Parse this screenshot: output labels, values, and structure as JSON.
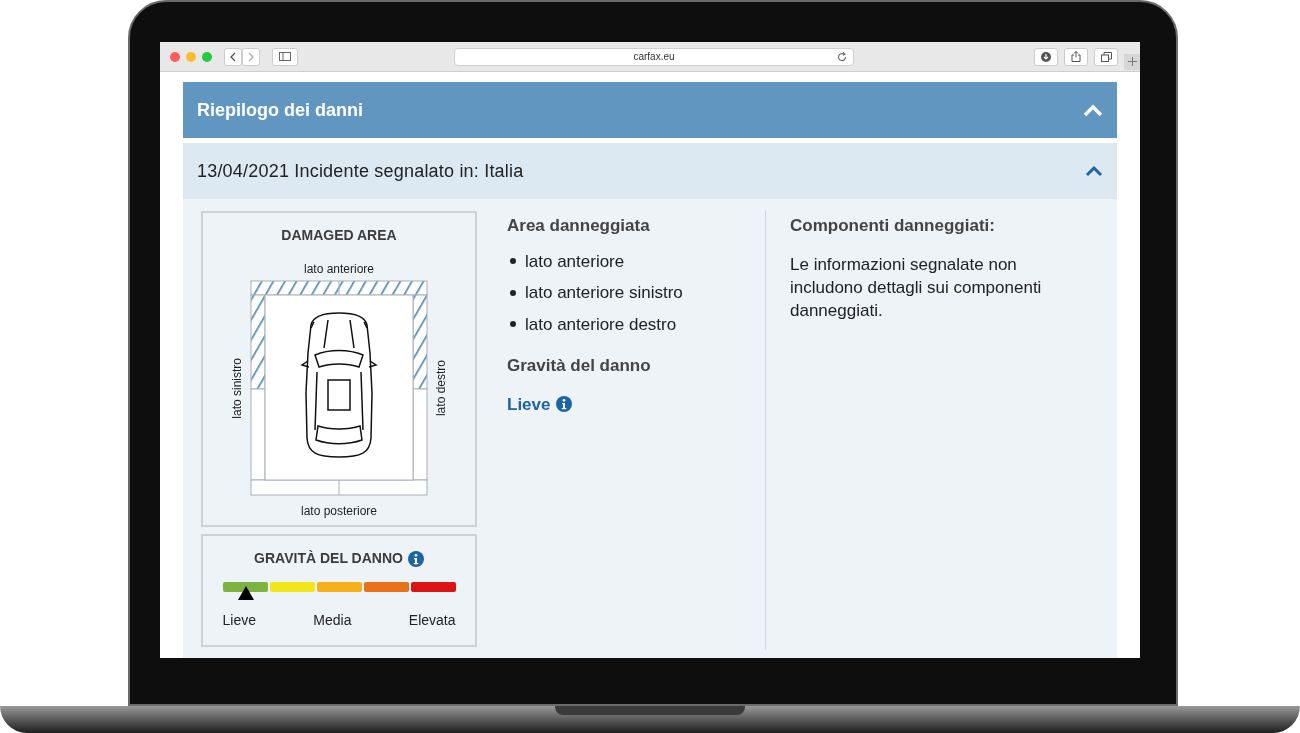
{
  "browser": {
    "url": "carfax.eu"
  },
  "section": {
    "title": "Riepilogo dei danni",
    "expanded": true
  },
  "incident": {
    "title": "13/04/2021 Incidente segnalato in: Italia",
    "expanded": true
  },
  "damaged_area": {
    "title": "DAMAGED AREA",
    "front_label": "lato anteriore",
    "left_label": "lato sinistro",
    "right_label": "lato destro",
    "rear_label": "lato posteriore",
    "zones": [
      {
        "kind": "front",
        "damaged": true
      },
      {
        "kind": "left-front",
        "damaged": true
      },
      {
        "kind": "right-front",
        "damaged": true
      },
      {
        "kind": "left-rear",
        "damaged": false
      },
      {
        "kind": "right-rear",
        "damaged": false
      },
      {
        "kind": "rear",
        "damaged": false
      }
    ]
  },
  "severity_meter": {
    "title": "GRAVITÀ DEL DANNO",
    "level": 0.1,
    "segments": [
      {
        "color": "#7cb342"
      },
      {
        "color": "#f2e51a"
      },
      {
        "color": "#f5b01a"
      },
      {
        "color": "#e8711a"
      },
      {
        "color": "#dc1414"
      }
    ],
    "labels": [
      "Lieve",
      "Media",
      "Elevata"
    ]
  },
  "area": {
    "title": "Area danneggiata",
    "items": [
      "lato anteriore",
      "lato anteriore sinistro",
      "lato anteriore destro"
    ]
  },
  "severity": {
    "title": "Gravità del danno",
    "value": "Lieve"
  },
  "components": {
    "title": "Componenti danneggiati:",
    "text": "Le informazioni segnalate non includono dettagli sui componenti danneggiati."
  }
}
